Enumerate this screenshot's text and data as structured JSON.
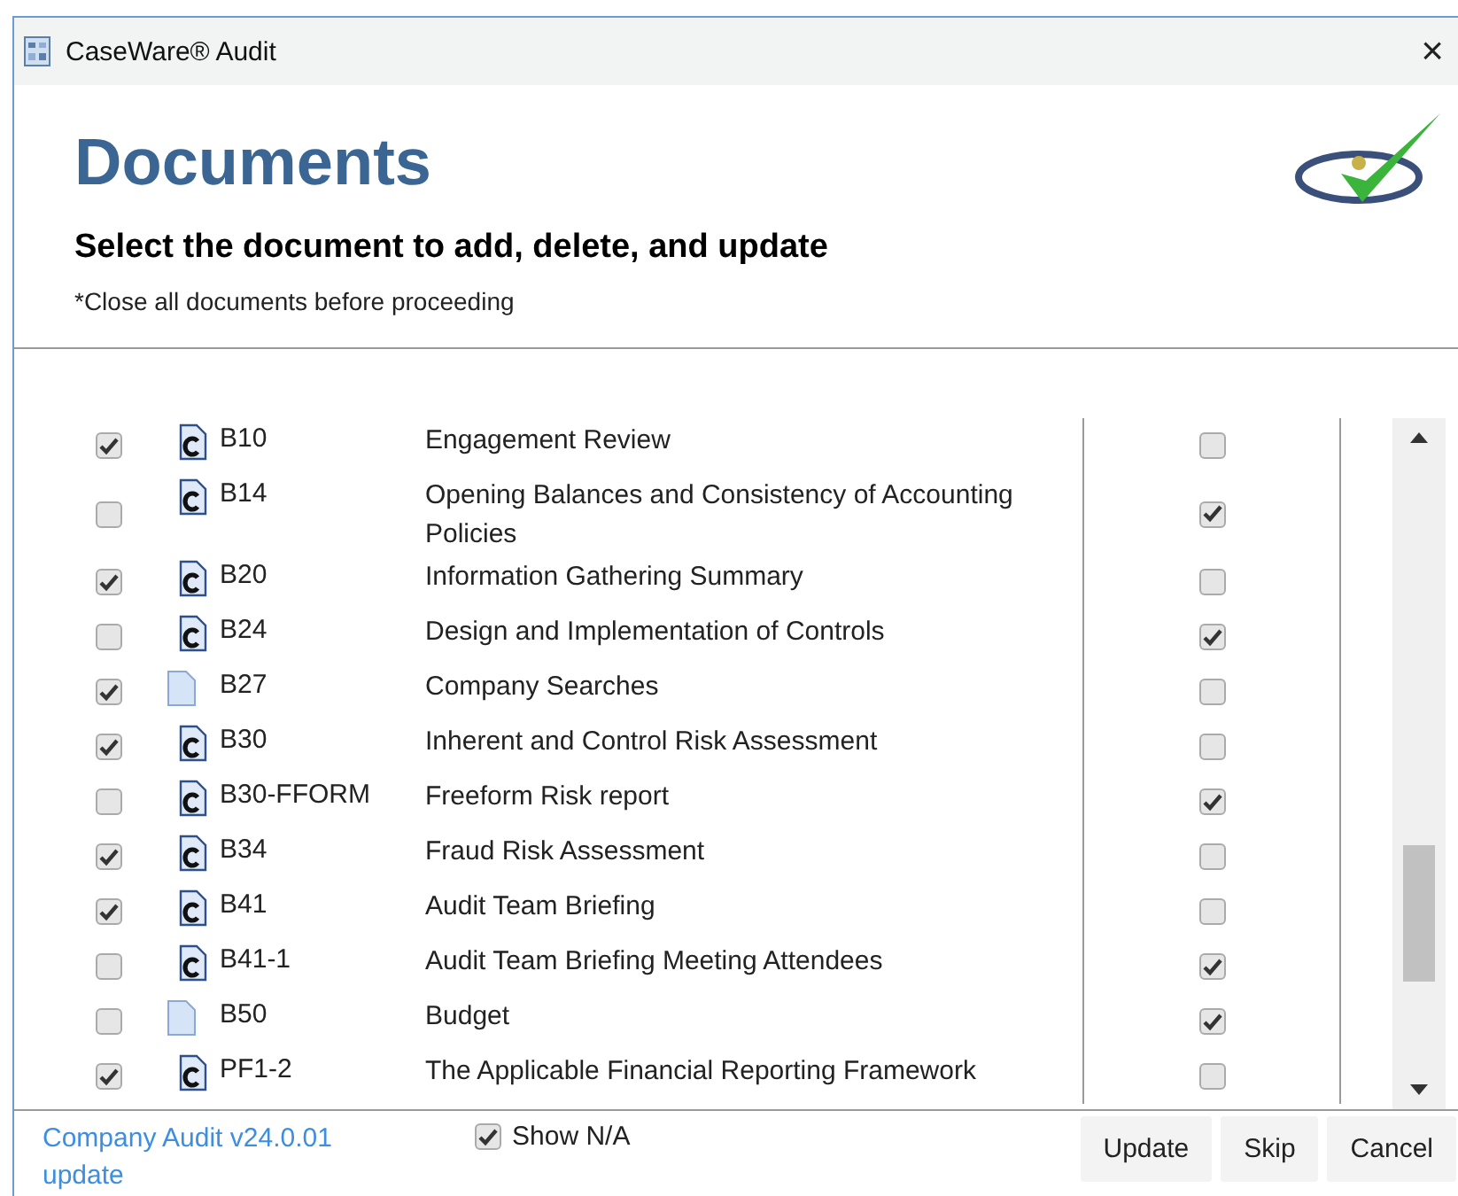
{
  "window": {
    "title": "CaseWare® Audit",
    "close": "×"
  },
  "header": {
    "title": "Documents",
    "subtitle": "Select the document to add, delete, and update",
    "note": "*Close all documents before proceeding"
  },
  "documents": [
    {
      "selected_left": true,
      "kind": "cdoc",
      "code": "B10",
      "name": "Engagement Review",
      "selected_right": false
    },
    {
      "selected_left": false,
      "kind": "cdoc",
      "code": "B14",
      "name": "Opening Balances and Consistency of Accounting Policies",
      "selected_right": true
    },
    {
      "selected_left": true,
      "kind": "cdoc",
      "code": "B20",
      "name": "Information Gathering Summary",
      "selected_right": false
    },
    {
      "selected_left": false,
      "kind": "cdoc",
      "code": "B24",
      "name": "Design and Implementation of Controls",
      "selected_right": true
    },
    {
      "selected_left": true,
      "kind": "page",
      "code": "B27",
      "name": "Company Searches",
      "selected_right": false
    },
    {
      "selected_left": true,
      "kind": "cdoc",
      "code": "B30",
      "name": "Inherent and Control Risk Assessment",
      "selected_right": false
    },
    {
      "selected_left": false,
      "kind": "cdoc",
      "code": "B30-FFORM",
      "name": "Freeform Risk report",
      "selected_right": true
    },
    {
      "selected_left": true,
      "kind": "cdoc",
      "code": "B34",
      "name": "Fraud Risk Assessment",
      "selected_right": false
    },
    {
      "selected_left": true,
      "kind": "cdoc",
      "code": "B41",
      "name": "Audit Team Briefing",
      "selected_right": false
    },
    {
      "selected_left": false,
      "kind": "cdoc",
      "code": "B41-1",
      "name": "Audit Team Briefing Meeting Attendees",
      "selected_right": true
    },
    {
      "selected_left": false,
      "kind": "page",
      "code": "B50",
      "name": "Budget",
      "selected_right": true
    },
    {
      "selected_left": true,
      "kind": "cdoc",
      "code": "PF1-2",
      "name": "The Applicable Financial Reporting Framework",
      "selected_right": false
    }
  ],
  "footer": {
    "link": "Company Audit v24.0.01 update",
    "show_na": {
      "label": "Show N/A",
      "checked": true
    },
    "buttons": [
      "Update",
      "Skip",
      "Cancel"
    ]
  }
}
